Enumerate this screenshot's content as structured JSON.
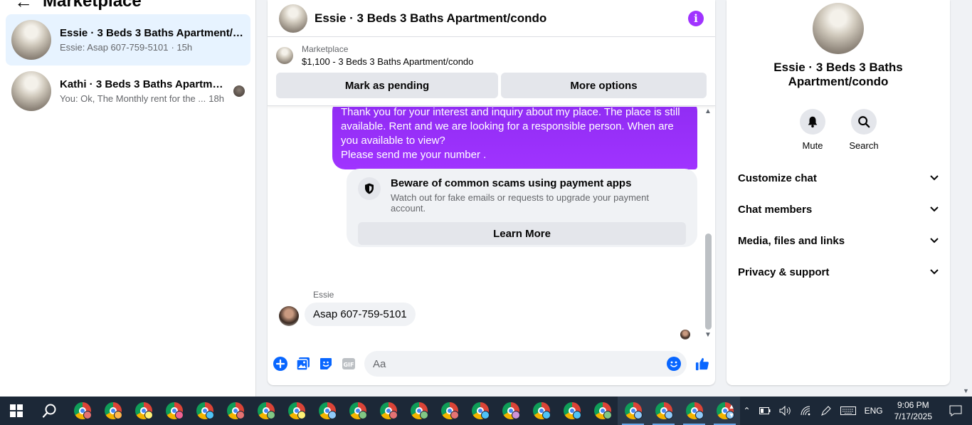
{
  "sidebar": {
    "title": "Marketplace",
    "conversations": [
      {
        "name": "Essie · 3 Beds 3 Baths Apartment/c...",
        "snippet": "Essie: Asap 607-759-5101",
        "time": "· 15h"
      },
      {
        "name": "Kathi · 3 Beds 3 Baths Apartmen...",
        "snippet": "You: Ok, The Monthly rent for the ...",
        "time": "18h"
      }
    ]
  },
  "chat": {
    "title": "Essie · 3 Beds 3 Baths Apartment/condo",
    "marketplace_label": "Marketplace",
    "listing": "$1,100 - 3 Beds 3 Baths Apartment/condo",
    "mark_pending": "Mark as pending",
    "more_options": "More options",
    "outgoing_message": "Thank you for your interest and inquiry about my place. The place is still available. Rent and we are looking for a responsible person. When are you available to view?\nPlease send me your number .",
    "scam_title": "Beware of common scams using payment apps",
    "scam_sub": "Watch out for fake emails or requests to upgrade your payment account.",
    "learn_more": "Learn More",
    "sender": "Essie",
    "incoming_message": "Asap 607-759-5101",
    "composer_placeholder": "Aa"
  },
  "info": {
    "name": "Essie · 3 Beds 3 Baths Apartment/condo",
    "mute": "Mute",
    "search": "Search",
    "sections": [
      "Customize chat",
      "Chat members",
      "Media, files and links",
      "Privacy & support"
    ]
  },
  "taskbar": {
    "language": "ENG",
    "time": "9:06 PM",
    "date": "7/17/2025"
  },
  "colors": {
    "accent": "#a033ff",
    "brand_blue": "#0866ff"
  }
}
